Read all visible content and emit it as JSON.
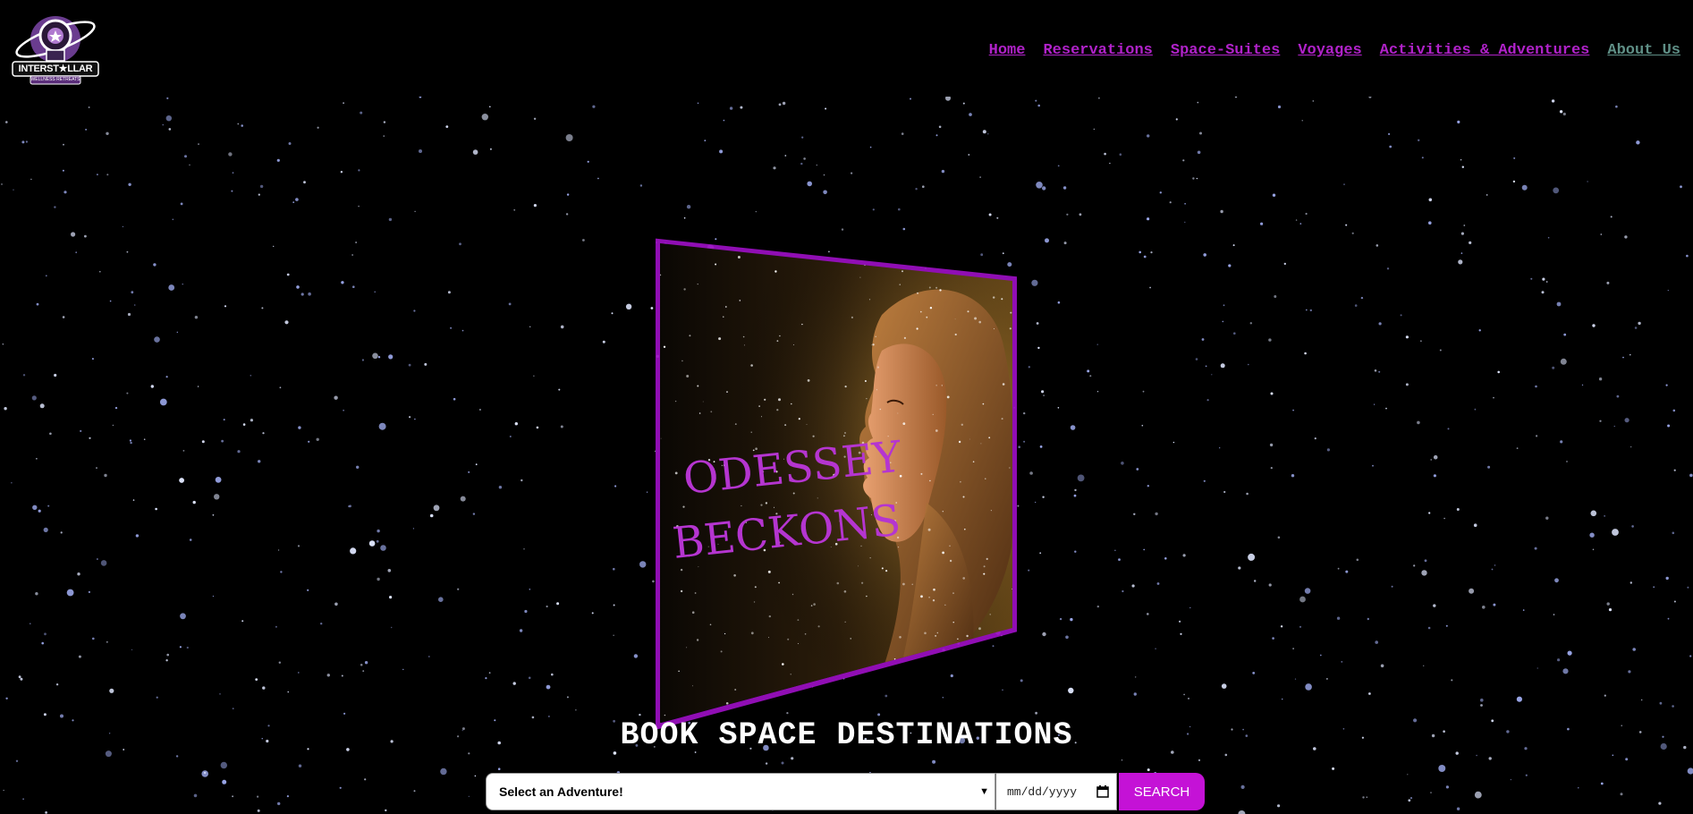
{
  "brand": {
    "logo_line1": "INTERST★LLAR",
    "logo_line2": "WELLNESS RETREATS"
  },
  "nav": {
    "items": [
      {
        "label": "Home",
        "visited": false
      },
      {
        "label": "Reservations",
        "visited": false
      },
      {
        "label": "Space-Suites",
        "visited": false
      },
      {
        "label": "Voyages",
        "visited": false
      },
      {
        "label": "Activities & Adventures",
        "visited": false
      },
      {
        "label": "About Us",
        "visited": true
      }
    ]
  },
  "hero": {
    "line1": "ODESSEY",
    "line2": "BECKONS"
  },
  "booking": {
    "title": "BOOK SPACE DESTINATIONS",
    "select_value": "Select an Adventure!",
    "date_placeholder": "mm/dd/yyyy",
    "search_label": "SEARCH"
  },
  "colors": {
    "accent": "#c412d6",
    "nav_link": "#b022c9",
    "nav_visited": "#5f8f86",
    "background": "#000000"
  },
  "icons": [
    "astronaut-logo-icon",
    "chevron-down-icon",
    "calendar-icon"
  ]
}
